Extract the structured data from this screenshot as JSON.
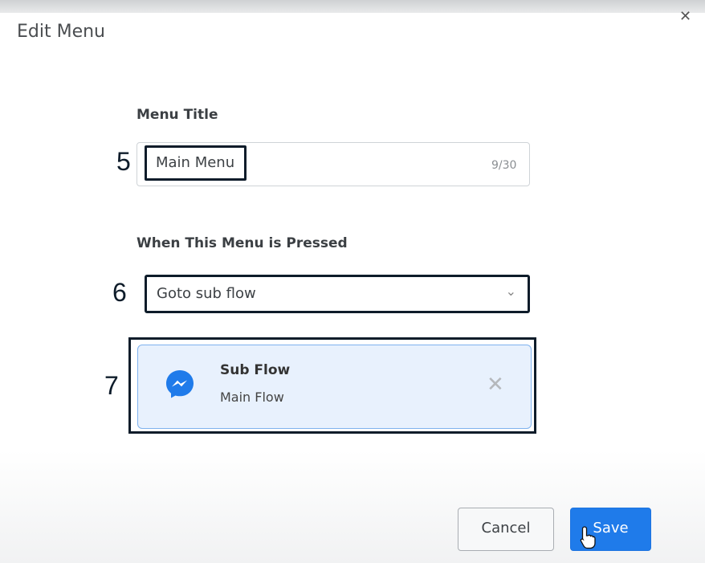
{
  "dialog": {
    "title": "Edit Menu",
    "close_icon": "close-icon"
  },
  "menu_title": {
    "label": "Menu Title",
    "value": "Main Menu",
    "counter": "9/30"
  },
  "on_press": {
    "label": "When This Menu is Pressed",
    "selected": "Goto sub flow",
    "icon": "chevron-down-icon"
  },
  "subflow_card": {
    "title": "Sub Flow",
    "subtitle": "Main Flow",
    "icon": "messenger-icon",
    "remove_icon": "close-icon"
  },
  "annotations": {
    "five": "5",
    "six": "6",
    "seven": "7"
  },
  "footer": {
    "cancel_label": "Cancel",
    "save_label": "Save"
  },
  "colors": {
    "accent": "#1f7bea",
    "highlight_border": "#0e1c2a",
    "card_bg": "#e8f1fd"
  }
}
